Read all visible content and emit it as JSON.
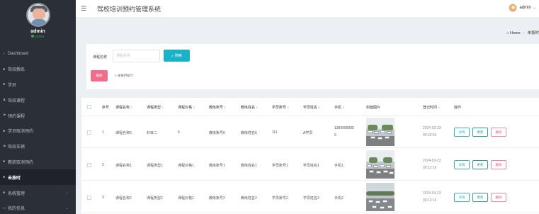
{
  "app": {
    "title": "驾校培训预约管理系统"
  },
  "user": {
    "name": "admin",
    "status": "Online",
    "menu_caret": "⌄"
  },
  "sidebar": {
    "profile_name": "admin",
    "profile_status": "Online",
    "items": [
      {
        "icon": "○",
        "label": "Dashboard"
      },
      {
        "icon": "■",
        "label": "驾校教练"
      },
      {
        "icon": "■",
        "label": "学员"
      },
      {
        "icon": "♟",
        "label": "驾校课程"
      },
      {
        "icon": "⚑",
        "label": "预约课程"
      },
      {
        "icon": "■",
        "label": "学员取消预约"
      },
      {
        "icon": "⚑",
        "label": "驾校车辆"
      },
      {
        "icon": "■",
        "label": "教练取消预约"
      },
      {
        "icon": "■",
        "label": "未按时",
        "active": true
      },
      {
        "icon": "■",
        "label": "系统管理",
        "chevron": "⌄"
      },
      {
        "icon": "▭",
        "label": "我的信息",
        "chevron": "⌄"
      }
    ]
  },
  "breadcrumb": {
    "home": "Home",
    "current": "未按时",
    "home_icon": "home-icon"
  },
  "search": {
    "label": "课程名称",
    "placeholder": "课程名称",
    "button": "搜索"
  },
  "toolbar": {
    "delete_label": "删除",
    "tip": "< 未按时统计"
  },
  "table": {
    "headers": {
      "index": "序号",
      "course_name": "课程名称",
      "course_type": "课程类型",
      "course_price": "课程价格",
      "coach_account": "教练账号",
      "coach_name": "教练姓名",
      "student_account": "学员账号",
      "student_name": "学员姓名",
      "phone": "手机",
      "cover": "封面图片",
      "register_time": "登记时间",
      "operation": "操作"
    },
    "rows": [
      {
        "index": "1",
        "course_name": "课程名称6",
        "course_type": "科目二",
        "course_price": "6",
        "coach_account": "教练账号6",
        "coach_name": "教练姓名6",
        "student_account": "111",
        "student_name": "A学员",
        "phone_line1": "1389999999",
        "phone_line2": "9",
        "date": "2024-03-23",
        "time": "09:22:53"
      },
      {
        "index": "2",
        "course_name": "课程名称1",
        "course_type": "课程类型1",
        "course_price": "课程价格1",
        "coach_account": "教练账号1",
        "coach_name": "教练姓名1",
        "student_account": "学员账号1",
        "student_name": "学员姓名1",
        "phone_line1": "手机1",
        "phone_line2": "",
        "date": "2024-03-23",
        "time": "09:12:16"
      },
      {
        "index": "3",
        "course_name": "课程名称2",
        "course_type": "课程类型2",
        "course_price": "课程价格2",
        "coach_account": "教练账号2",
        "coach_name": "教练姓名2",
        "student_account": "学员账号2",
        "student_name": "学员姓名2",
        "phone_line1": "手机2",
        "phone_line2": "",
        "date": "2024-03-23",
        "time": "09:12:16"
      }
    ],
    "actions": {
      "detail": "详情",
      "update": "更新",
      "delete": "删除"
    },
    "sort_icon": "⇕"
  },
  "colors": {
    "sidebar_bg": "#2b3038",
    "search_button": "#1ab2c7",
    "delete_button": "#f06e8c",
    "online": "#3aa55b"
  }
}
